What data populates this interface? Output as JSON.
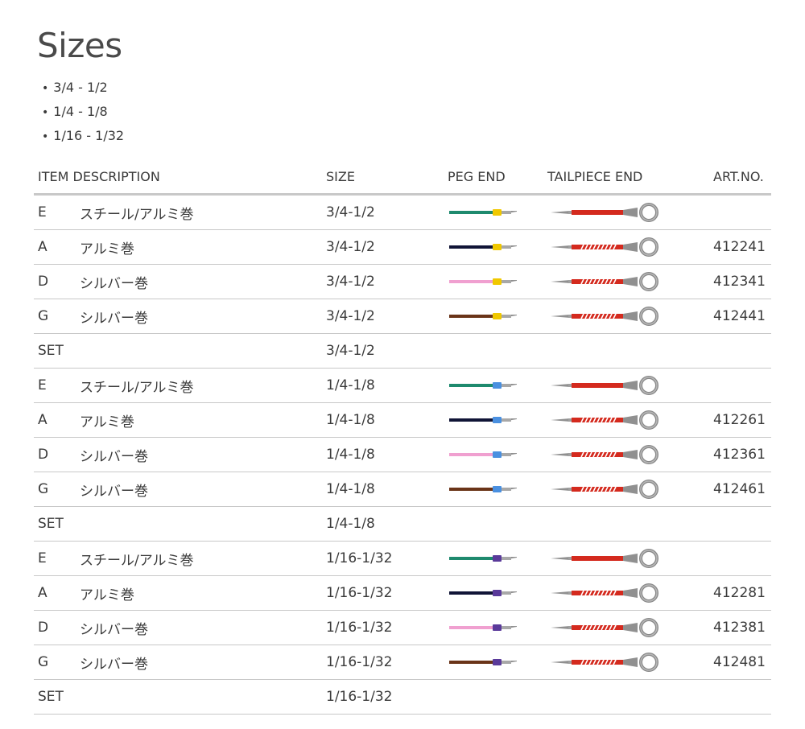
{
  "title": "Sizes",
  "sizes": [
    "3/4 - 1/2",
    "1/4 - 1/8",
    "1/16 - 1/32"
  ],
  "columns": {
    "item_description": "ITEM DESCRIPTION",
    "size": "SIZE",
    "peg_end": "PEG END",
    "tailpiece_end": "TAILPIECE END",
    "art_no": "ART.NO."
  },
  "colors": {
    "E": "#1e8a6e",
    "A": "#101436",
    "D": "#f0a0d0",
    "G": "#6a3418",
    "size_3_4": "#f0c800",
    "size_1_4": "#4a90e0",
    "size_1_16": "#5a3a9a",
    "tail_red": "#d42a1e",
    "metal": "#909090"
  },
  "rows": [
    {
      "type": "string",
      "letter": "E",
      "desc": "スチール/アルミ巻",
      "size": "3/4-1/2",
      "peg": "E",
      "band": "size_3_4",
      "tail": "plain",
      "art": ""
    },
    {
      "type": "string",
      "letter": "A",
      "desc": "アルミ巻",
      "size": "3/4-1/2",
      "peg": "A",
      "band": "size_3_4",
      "tail": "wound",
      "art": "412241"
    },
    {
      "type": "string",
      "letter": "D",
      "desc": "シルバー巻",
      "size": "3/4-1/2",
      "peg": "D",
      "band": "size_3_4",
      "tail": "wound",
      "art": "412341"
    },
    {
      "type": "string",
      "letter": "G",
      "desc": "シルバー巻",
      "size": "3/4-1/2",
      "peg": "G",
      "band": "size_3_4",
      "tail": "wound",
      "art": "412441"
    },
    {
      "type": "set",
      "letter": "SET",
      "desc": "",
      "size": "3/4-1/2",
      "art": ""
    },
    {
      "type": "string",
      "letter": "E",
      "desc": "スチール/アルミ巻",
      "size": "1/4-1/8",
      "peg": "E",
      "band": "size_1_4",
      "tail": "plain",
      "art": ""
    },
    {
      "type": "string",
      "letter": "A",
      "desc": "アルミ巻",
      "size": "1/4-1/8",
      "peg": "A",
      "band": "size_1_4",
      "tail": "wound",
      "art": "412261"
    },
    {
      "type": "string",
      "letter": "D",
      "desc": "シルバー巻",
      "size": "1/4-1/8",
      "peg": "D",
      "band": "size_1_4",
      "tail": "wound",
      "art": "412361"
    },
    {
      "type": "string",
      "letter": "G",
      "desc": "シルバー巻",
      "size": "1/4-1/8",
      "peg": "G",
      "band": "size_1_4",
      "tail": "wound",
      "art": "412461"
    },
    {
      "type": "set",
      "letter": "SET",
      "desc": "",
      "size": "1/4-1/8",
      "art": ""
    },
    {
      "type": "string",
      "letter": "E",
      "desc": "スチール/アルミ巻",
      "size": "1/16-1/32",
      "peg": "E",
      "band": "size_1_16",
      "tail": "plain",
      "art": ""
    },
    {
      "type": "string",
      "letter": "A",
      "desc": "アルミ巻",
      "size": "1/16-1/32",
      "peg": "A",
      "band": "size_1_16",
      "tail": "wound",
      "art": "412281"
    },
    {
      "type": "string",
      "letter": "D",
      "desc": "シルバー巻",
      "size": "1/16-1/32",
      "peg": "D",
      "band": "size_1_16",
      "tail": "wound",
      "art": "412381"
    },
    {
      "type": "string",
      "letter": "G",
      "desc": "シルバー巻",
      "size": "1/16-1/32",
      "peg": "G",
      "band": "size_1_16",
      "tail": "wound",
      "art": "412481"
    },
    {
      "type": "set",
      "letter": "SET",
      "desc": "",
      "size": "1/16-1/32",
      "art": ""
    }
  ]
}
